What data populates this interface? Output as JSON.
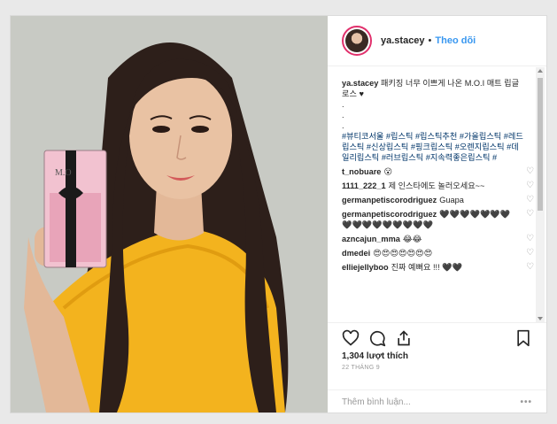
{
  "header": {
    "username": "ya.stacey",
    "separator": "•",
    "follow_label": "Theo dõi"
  },
  "caption": {
    "username": "ya.stacey",
    "text": "패키징 너무 이쁘게 나온 M.O.I 매트 립글로스 ♥",
    "dots": [
      ".",
      ".",
      "."
    ],
    "hashtags": "#뷰티코서울 #립스틱 #립스틱추천 #가을립스틱 #레드립스틱 #신상립스틱 #핑크립스틱 #오렌지립스틱 #데일리립스틱 #러브립스틱 #지속력좋은립스틱 #"
  },
  "comments": [
    {
      "user": "t_nobuare",
      "text": "😮"
    },
    {
      "user": "1111_222_1",
      "text": "제 인스타에도 놀러오세요~~"
    },
    {
      "user": "germanpetiscorodriguez",
      "text": "Guapa"
    },
    {
      "user": "germanpetiscorodriguez",
      "text": "🖤🖤🖤🖤🖤🖤🖤🖤🖤🖤🖤🖤🖤🖤🖤🖤"
    },
    {
      "user": "azncajun_mma",
      "text": "😂😂"
    },
    {
      "user": "dmedei",
      "text": "😍😍😍😍😍😍😍"
    },
    {
      "user": "elliejellyboo",
      "text": "진짜 예뻐요 !!! 🖤🖤"
    }
  ],
  "actions": {
    "likes": "1,304 lượt thích",
    "date": "22 THÁNG 9",
    "add_comment_placeholder": "Thêm bình luận...",
    "more_label": "•••"
  },
  "icons": {
    "like": "heart-icon",
    "comment": "comment-icon",
    "share": "share-icon",
    "save": "bookmark-icon",
    "comment_like": "heart-outline-icon"
  },
  "colors": {
    "link": "#3897f0",
    "story_ring": "#e1306c",
    "hashtag": "#003569",
    "top_color": "#f6b21c"
  }
}
